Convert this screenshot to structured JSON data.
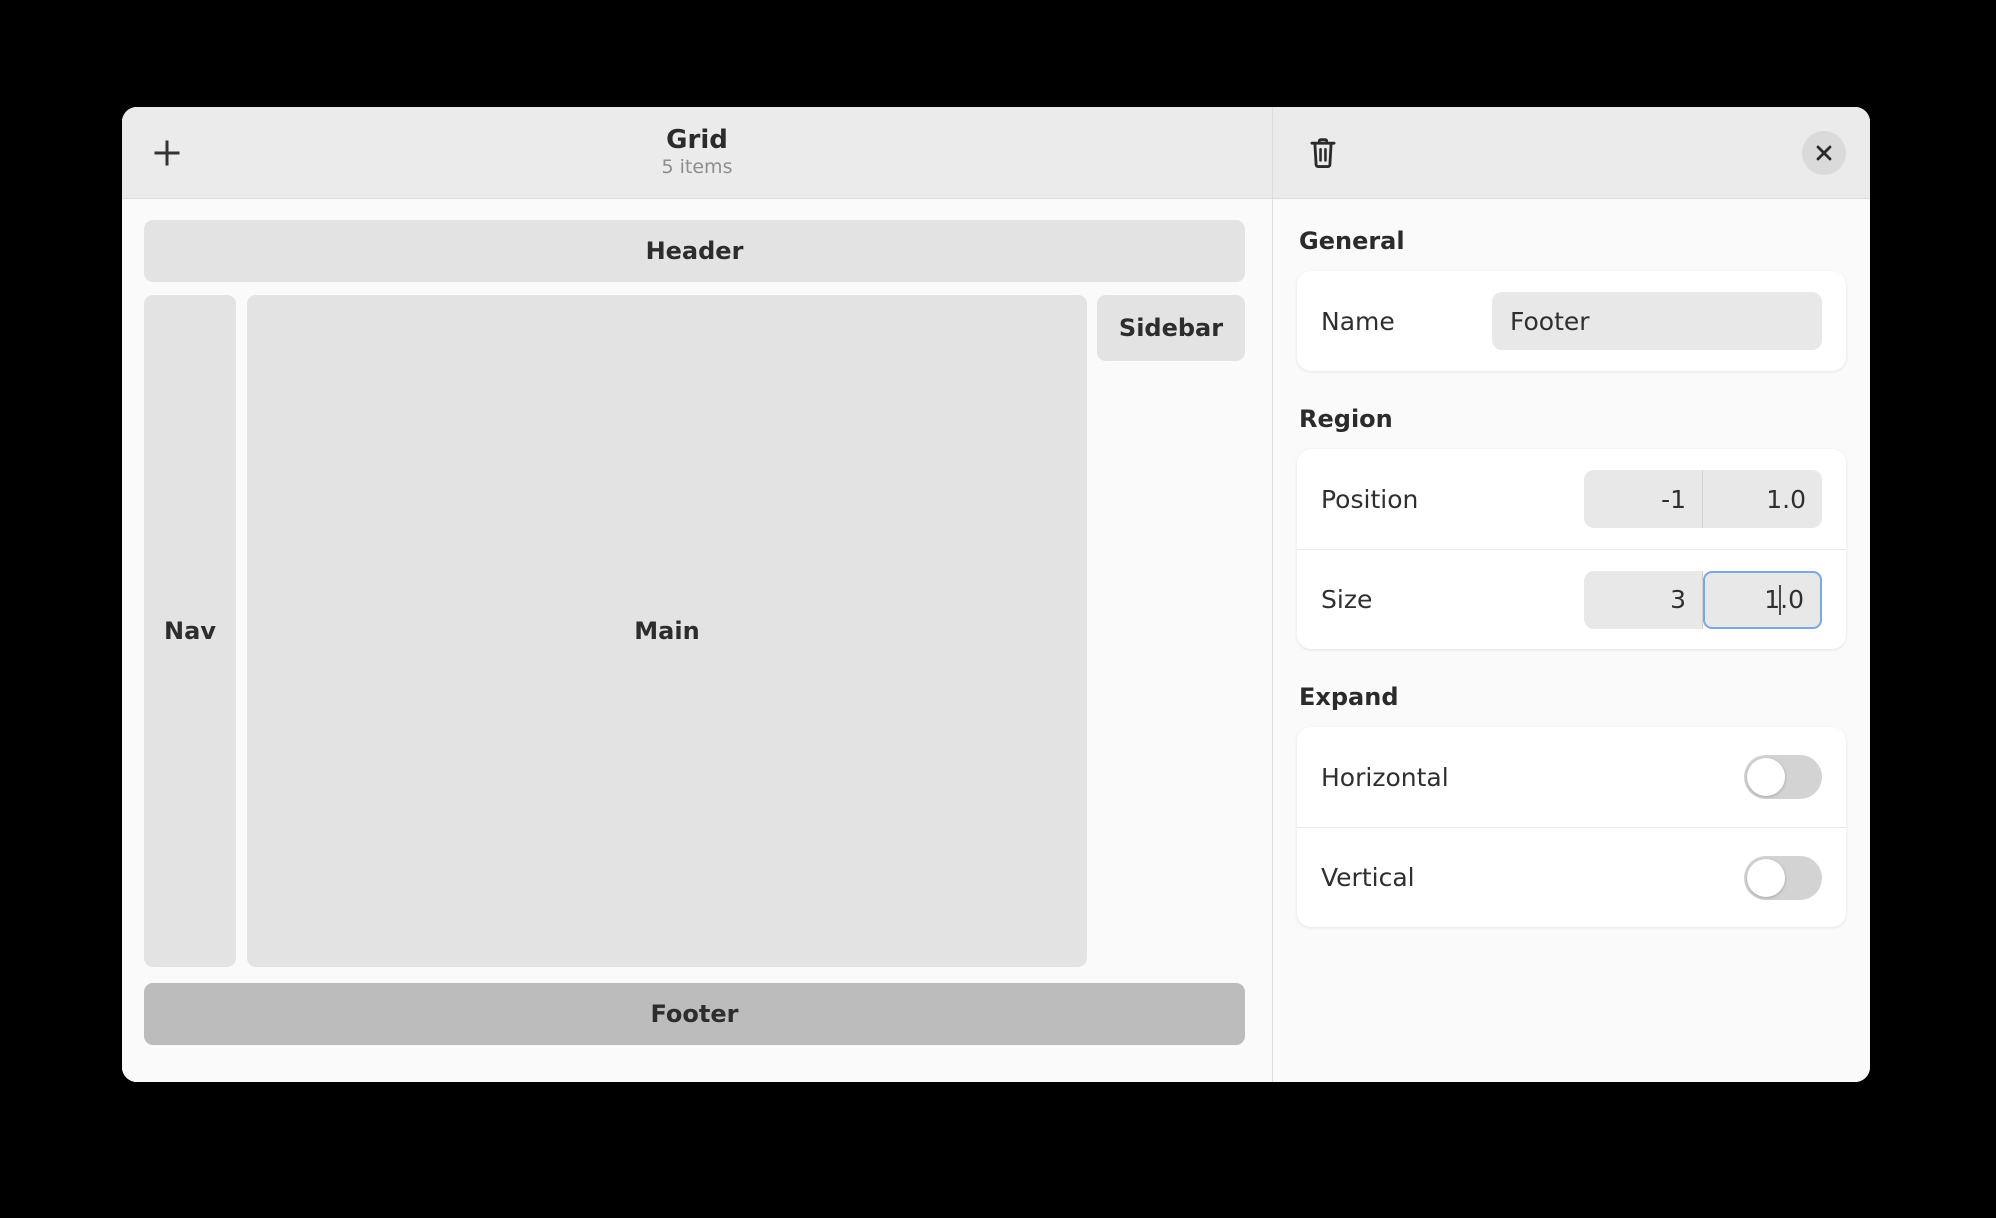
{
  "editor": {
    "title": "Grid",
    "subtitle": "5 items",
    "add_icon": "plus-icon",
    "blocks": [
      {
        "id": "header",
        "label": "Header",
        "selected": false
      },
      {
        "id": "nav",
        "label": "Nav",
        "selected": false
      },
      {
        "id": "main",
        "label": "Main",
        "selected": false
      },
      {
        "id": "sidebar",
        "label": "Sidebar",
        "selected": false
      },
      {
        "id": "footer",
        "label": "Footer",
        "selected": true
      }
    ]
  },
  "inspector": {
    "delete_icon": "trash-icon",
    "close_icon": "close-icon",
    "sections": {
      "general": {
        "title": "General",
        "name_label": "Name",
        "name_value": "Footer"
      },
      "region": {
        "title": "Region",
        "position_label": "Position",
        "position_x": "-1",
        "position_y": "1.0",
        "size_label": "Size",
        "size_w": "3",
        "size_h_before_caret": "1",
        "size_h_after_caret": ".0"
      },
      "expand": {
        "title": "Expand",
        "horizontal_label": "Horizontal",
        "horizontal_on": false,
        "vertical_label": "Vertical",
        "vertical_on": false
      }
    }
  },
  "colors": {
    "canvas": "#fafafa",
    "header_bar": "#ebebeb",
    "block": "#e3e3e3",
    "block_selected": "#bcbcbc",
    "field": "#e8e8e8",
    "focus_ring": "#7aa9e0",
    "toggle_off": "#d3d3d3"
  }
}
